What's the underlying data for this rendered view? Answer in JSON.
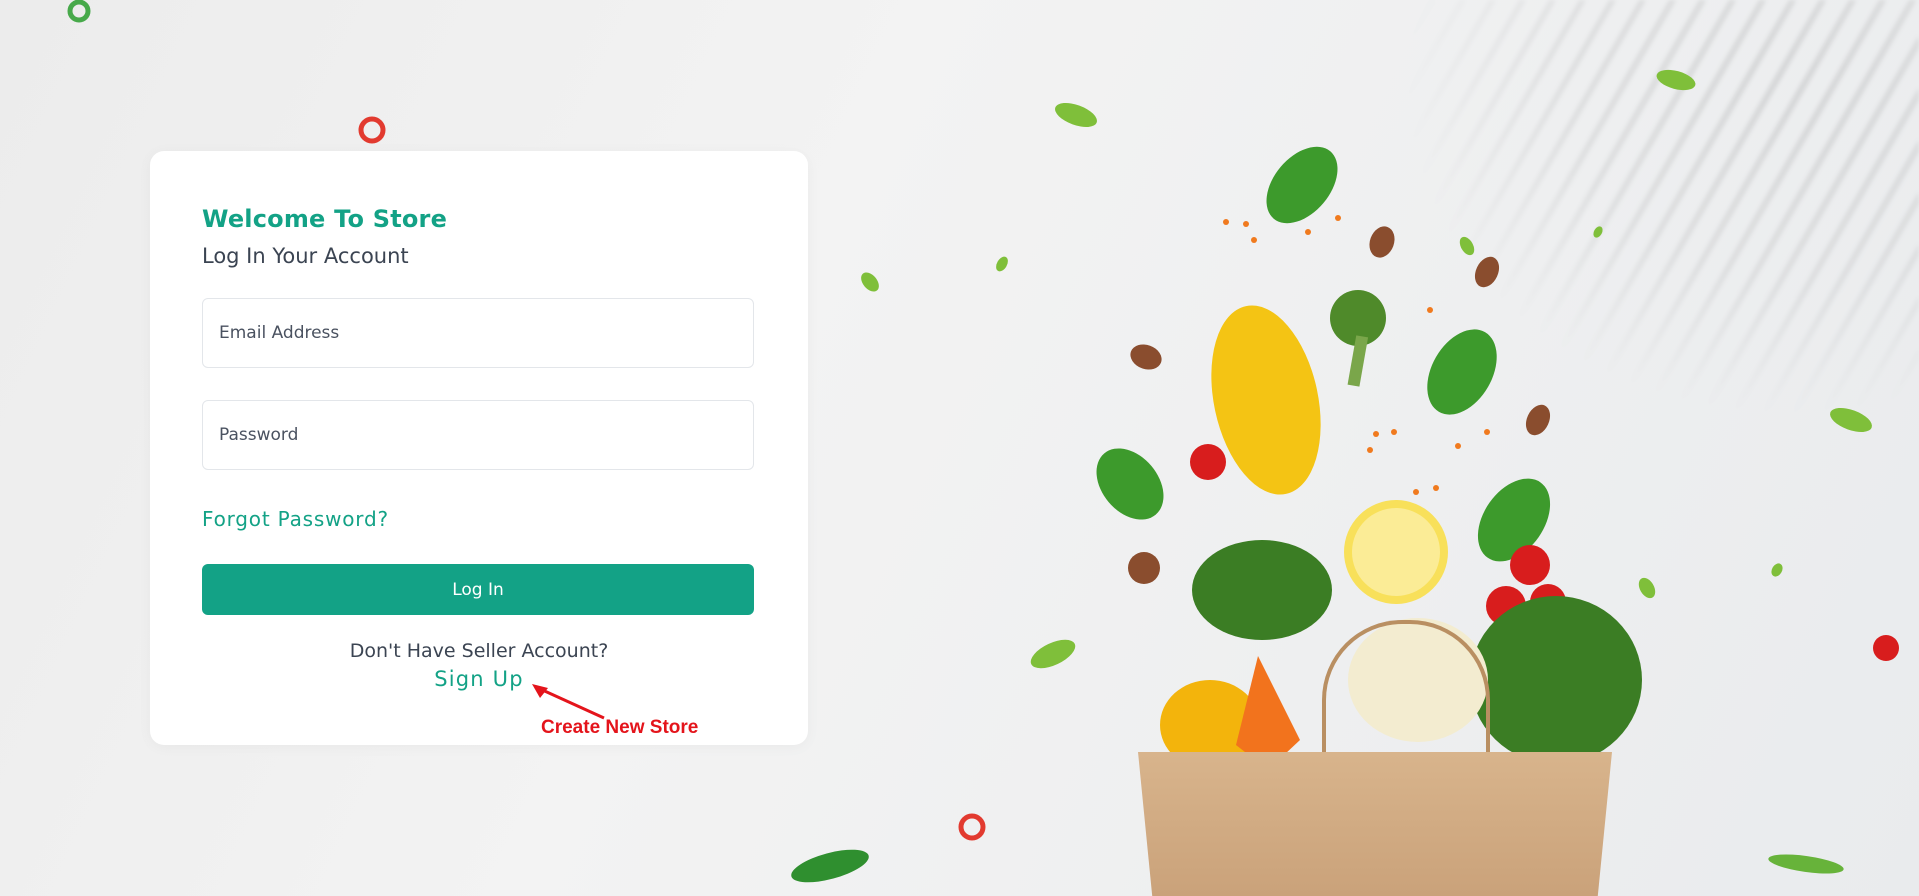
{
  "login": {
    "welcome_title": "Welcome To Store",
    "subtitle": "Log In Your Account",
    "email_placeholder": "Email Address",
    "password_placeholder": "Password",
    "forgot_label": "Forgot Password?",
    "login_label": "Log In",
    "no_account_text": "Don't Have Seller Account?",
    "signup_label": "Sign Up"
  },
  "annotation": {
    "text": "Create New Store",
    "color": "#e4141b"
  },
  "theme": {
    "accent": "#13a286"
  }
}
